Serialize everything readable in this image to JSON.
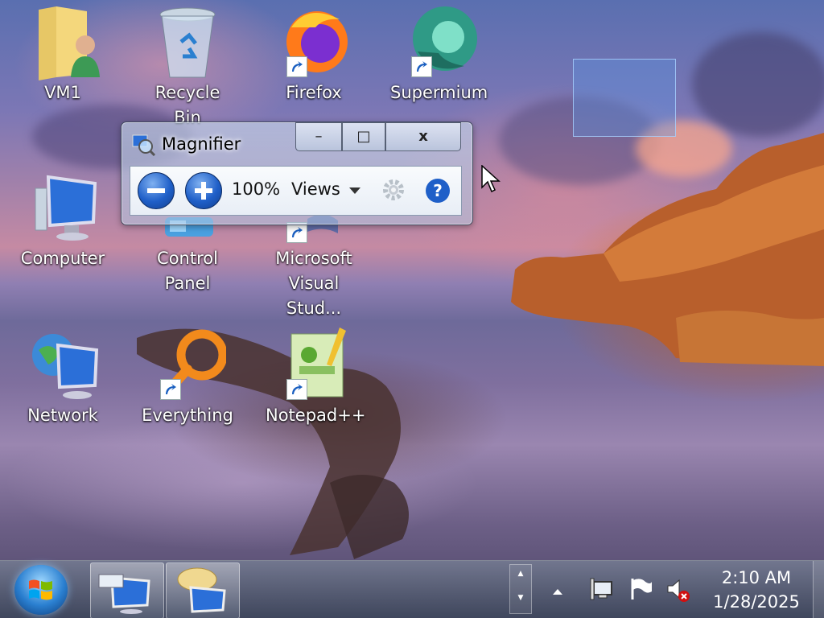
{
  "desktop": {
    "icons": [
      {
        "label": "VM1",
        "icon": "user-folder-icon"
      },
      {
        "label": "Recycle Bin",
        "icon": "recycle-bin-icon"
      },
      {
        "label": "Firefox",
        "icon": "firefox-icon",
        "shortcut": true
      },
      {
        "label": "Supermium",
        "icon": "supermium-icon",
        "shortcut": true
      },
      {
        "label": "Computer",
        "icon": "computer-icon"
      },
      {
        "label": "Control Panel",
        "icon": "control-panel-icon"
      },
      {
        "label": "Microsoft Visual Stud...",
        "icon": "visual-studio-icon",
        "shortcut": true
      },
      {
        "label": "Network",
        "icon": "network-icon"
      },
      {
        "label": "Everything",
        "icon": "everything-search-icon",
        "shortcut": true
      },
      {
        "label": "Notepad++",
        "icon": "notepad-plus-plus-icon",
        "shortcut": true
      }
    ]
  },
  "magnifier": {
    "title": "Magnifier",
    "minimize_label": "–",
    "maximize_label": "□",
    "close_label": "x",
    "zoom": "100%",
    "views_label": "Views"
  },
  "taskbar": {
    "time": "2:10 AM",
    "date": "1/28/2025",
    "overflow_up": "▲",
    "overflow_down": "▼"
  }
}
